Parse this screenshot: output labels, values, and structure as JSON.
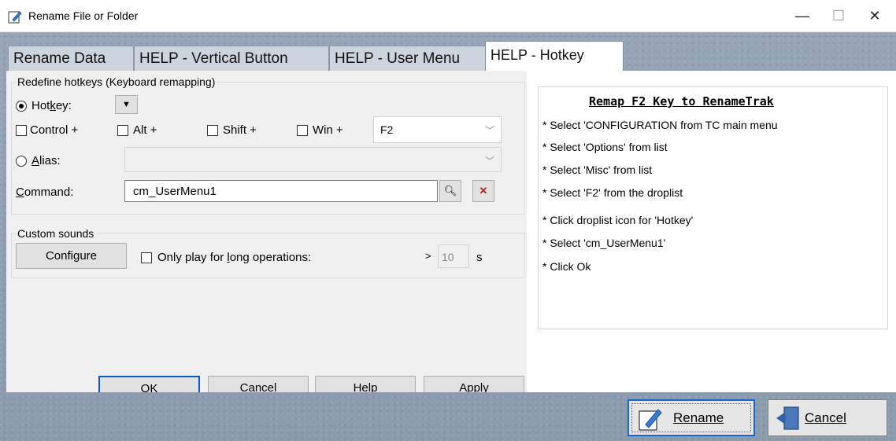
{
  "window": {
    "title": "Rename File or Folder",
    "minimize_glyph": "—",
    "maximize_glyph": "☐",
    "close_glyph": "✕",
    "icon": "rename-pencil-icon"
  },
  "tabs": [
    {
      "label": "Rename Data"
    },
    {
      "label": "HELP - Vertical Button"
    },
    {
      "label": "HELP - User Menu"
    },
    {
      "label": "HELP - Hotkey",
      "active": true
    }
  ],
  "hotkey_group": {
    "title": "Redefine hotkeys (Keyboard remapping)",
    "hotkey_label": "Hotkey:",
    "hotkey_underline": "k",
    "control_label": "Control +",
    "alt_label": "Alt +",
    "shift_label": "Shift +",
    "win_label": "Win +",
    "key_value": "F2",
    "alias_label": "Alias:",
    "alias_value": "",
    "command_label": "Command:",
    "command_value": "cm_UserMenu1"
  },
  "sounds_group": {
    "title": "Custom sounds",
    "configure_label": "Configure",
    "long_ops_label": "Only play for long operations:",
    "gt": ">",
    "seconds_value": "10",
    "seconds_unit": "s"
  },
  "dialog_buttons": {
    "ok": "OK",
    "cancel": "Cancel",
    "help": "Help",
    "apply": "Apply"
  },
  "help": {
    "title": "Remap F2 Key to RenameTrak",
    "lines": [
      "* Select 'CONFIGURATION from TC main menu",
      "* Select 'Options' from list",
      "* Select 'Misc' from list",
      "* Select 'F2' from the droplist",
      "* Click droplist icon for 'Hotkey'",
      "* Select 'cm_UserMenu1'",
      "* Click Ok"
    ]
  },
  "main_buttons": {
    "rename": "Rename",
    "cancel": "Cancel"
  },
  "colors": {
    "background": "#8f9fb2",
    "dialog_gray": "#f0f0f0",
    "focus_blue": "#1a66cc"
  }
}
